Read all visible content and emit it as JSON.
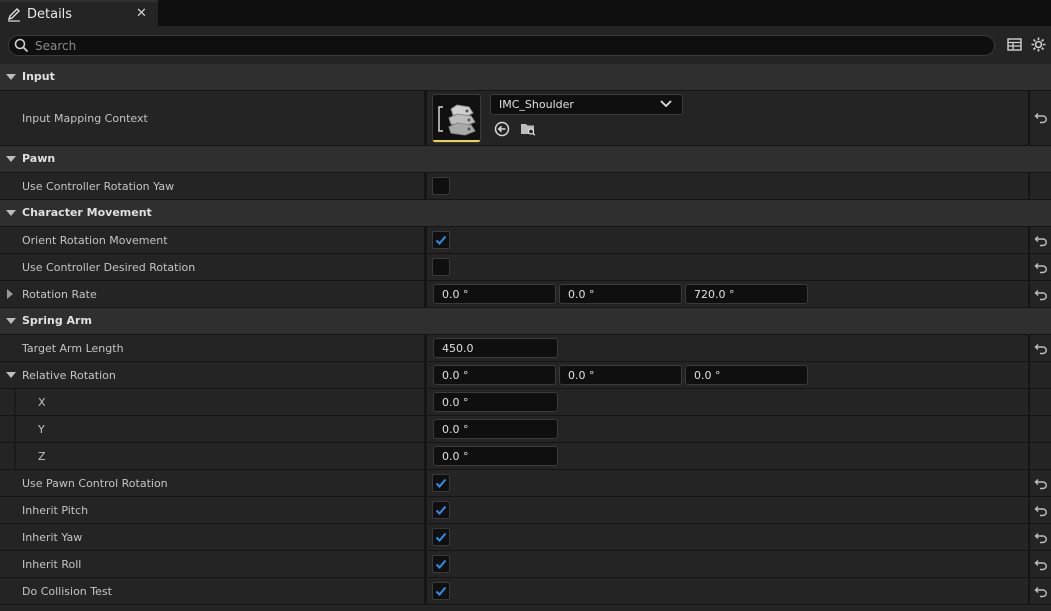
{
  "tab": {
    "label": "Details",
    "close": "✕"
  },
  "search": {
    "placeholder": "Search",
    "value": ""
  },
  "categories": {
    "input": "Input",
    "pawn": "Pawn",
    "character_movement": "Character Movement",
    "spring_arm": "Spring Arm"
  },
  "properties": {
    "input_mapping_context": {
      "label": "Input Mapping Context",
      "value": "IMC_Shoulder"
    },
    "use_controller_rotation_yaw": {
      "label": "Use Controller Rotation Yaw",
      "checked": false
    },
    "orient_rotation_movement": {
      "label": "Orient Rotation Movement",
      "checked": true
    },
    "use_controller_desired_rotation": {
      "label": "Use Controller Desired Rotation",
      "checked": false
    },
    "rotation_rate": {
      "label": "Rotation Rate",
      "x": "0.0 °",
      "y": "0.0 °",
      "z": "720.0 °"
    },
    "target_arm_length": {
      "label": "Target Arm Length",
      "value": "450.0"
    },
    "relative_rotation": {
      "label": "Relative Rotation",
      "x": "0.0 °",
      "y": "0.0 °",
      "z": "0.0 °",
      "x_label": "X",
      "y_label": "Y",
      "z_label": "Z",
      "x_value": "0.0 °",
      "y_value": "0.0 °",
      "z_value": "0.0 °"
    },
    "use_pawn_control_rotation": {
      "label": "Use Pawn Control Rotation",
      "checked": true
    },
    "inherit_pitch": {
      "label": "Inherit Pitch",
      "checked": true
    },
    "inherit_yaw": {
      "label": "Inherit Yaw",
      "checked": true
    },
    "inherit_roll": {
      "label": "Inherit Roll",
      "checked": true
    },
    "do_collision_test": {
      "label": "Do Collision Test",
      "checked": true
    }
  },
  "colors": {
    "accent": "#2f8fe8",
    "background": "#242424",
    "category": "#2f2f2f",
    "highlight": "#e6d64a"
  },
  "icons": {
    "tab": "pencil-icon",
    "search": "search-icon",
    "table_view": "table-icon",
    "settings": "gear-icon",
    "reset": "reset-arrow-icon",
    "browse": "browse-to-asset-icon",
    "find": "find-in-browser-icon"
  }
}
